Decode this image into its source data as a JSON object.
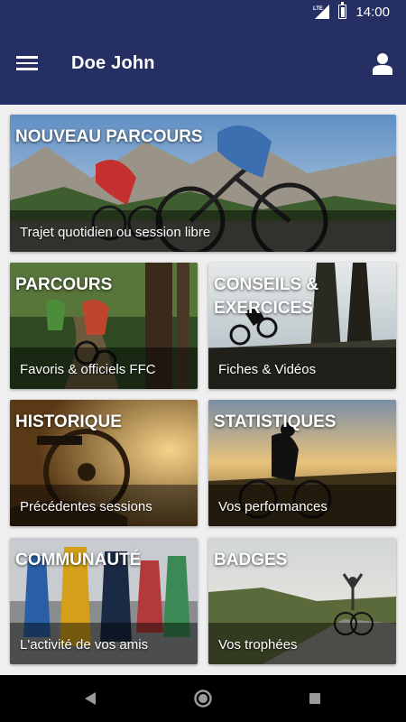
{
  "status_bar": {
    "network": "LTE",
    "time": "14:00",
    "icons": [
      "signal-icon",
      "battery-icon"
    ]
  },
  "app_bar": {
    "title": "Doe John",
    "menu_icon": "menu-icon",
    "user_icon": "user-icon"
  },
  "tiles": [
    {
      "id": "nouveau-parcours",
      "title": "NOUVEAU PARCOURS",
      "subtitle": "Trajet quotidien ou session libre"
    },
    {
      "id": "parcours",
      "title": "PARCOURS",
      "subtitle": "Favoris & officiels FFC"
    },
    {
      "id": "conseils",
      "title": "CONSEILS & EXERCICES",
      "subtitle": "Fiches & Vidéos"
    },
    {
      "id": "historique",
      "title": "HISTORIQUE",
      "subtitle": "Précédentes sessions"
    },
    {
      "id": "statistiques",
      "title": "STATISTIQUES",
      "subtitle": "Vos performances"
    },
    {
      "id": "communaute",
      "title": "COMMUNAUTÉ",
      "subtitle": "L'activité de vos amis"
    },
    {
      "id": "badges",
      "title": "BADGES",
      "subtitle": "Vos trophées"
    }
  ],
  "nav_bar": {
    "buttons": [
      "back-icon",
      "home-icon",
      "recents-icon"
    ]
  },
  "colors": {
    "header": "#262f63",
    "background": "#efefef",
    "nav_bar": "#000000"
  }
}
